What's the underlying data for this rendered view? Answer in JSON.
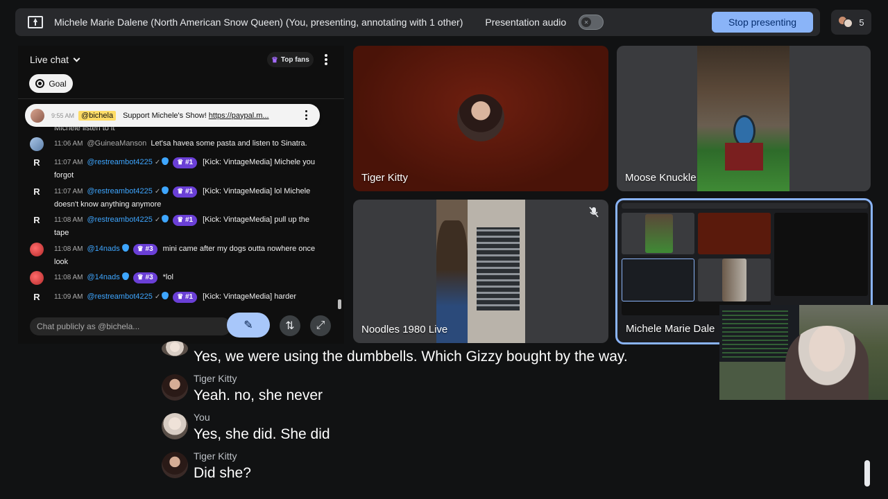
{
  "topbar": {
    "presenter_text": "Michele Marie Dalene (North American Snow Queen) (You, presenting, annotating with 1 other)",
    "audio_label": "Presentation audio",
    "stop_label": "Stop presenting",
    "participant_count": "5"
  },
  "chat": {
    "title": "Live chat",
    "top_fans_label": "Top fans",
    "goal_label": "Goal",
    "pinned": {
      "time": "9:55 AM",
      "user": "@bichela",
      "message": "Support Michele's Show!",
      "link": "https://paypal.m..."
    },
    "partial_message": "Michele listen to it",
    "messages": [
      {
        "avatar": "",
        "time": "11:06 AM",
        "user": "@GuineaManson",
        "rank": "",
        "text": "Let'sa havea some pasta and listen to Sinatra."
      },
      {
        "avatar": "R",
        "time": "11:07 AM",
        "user": "@restreambot4225",
        "rank": "#1",
        "text": "[Kick: VintageMedia] Michele you forgot"
      },
      {
        "avatar": "R",
        "time": "11:07 AM",
        "user": "@restreambot4225",
        "rank": "#1",
        "text": "[Kick: VintageMedia] lol Michele doesn't know anything anymore"
      },
      {
        "avatar": "R",
        "time": "11:08 AM",
        "user": "@restreambot4225",
        "rank": "#1",
        "text": "[Kick: VintageMedia] pull up the tape"
      },
      {
        "avatar": "",
        "time": "11:08 AM",
        "user": "@14nads",
        "rank": "#3",
        "text": "mini came after my dogs outta nowhere once look"
      },
      {
        "avatar": "",
        "time": "11:08 AM",
        "user": "@14nads",
        "rank": "#3",
        "text": "*lol"
      },
      {
        "avatar": "R",
        "time": "11:09 AM",
        "user": "@restreambot4225",
        "rank": "#1",
        "text": "[Kick: VintageMedia] harder"
      }
    ],
    "input_placeholder": "Chat publicly as @bichela..."
  },
  "tiles": [
    {
      "name": "Tiger Kitty"
    },
    {
      "name": "Moose Knuckle"
    },
    {
      "name": "Noodles 1980 Live"
    },
    {
      "name": "Michele Marie Dale"
    }
  ],
  "captions": [
    {
      "speaker": "",
      "text": "Yes, we were using the dumbbells. Which Gizzy bought by the way."
    },
    {
      "speaker": "Tiger Kitty",
      "text": "Yeah. no, she never"
    },
    {
      "speaker": "You",
      "text": "Yes, she did. She did"
    },
    {
      "speaker": "Tiger Kitty",
      "text": "Did she?"
    }
  ],
  "colors": {
    "accent": "#8ab4f8",
    "stop_button": "#8ab4f8",
    "rank_badge": "#6a3fd6",
    "username": "#3ea6ff",
    "pinned_user_highlight": "#fedc66"
  },
  "icons": {
    "present": "present-to-all-icon",
    "annotate": "pen-icon",
    "swap": "swap-vertical-icon",
    "expand": "expand-icon",
    "mic_off": "mic-off-icon"
  }
}
